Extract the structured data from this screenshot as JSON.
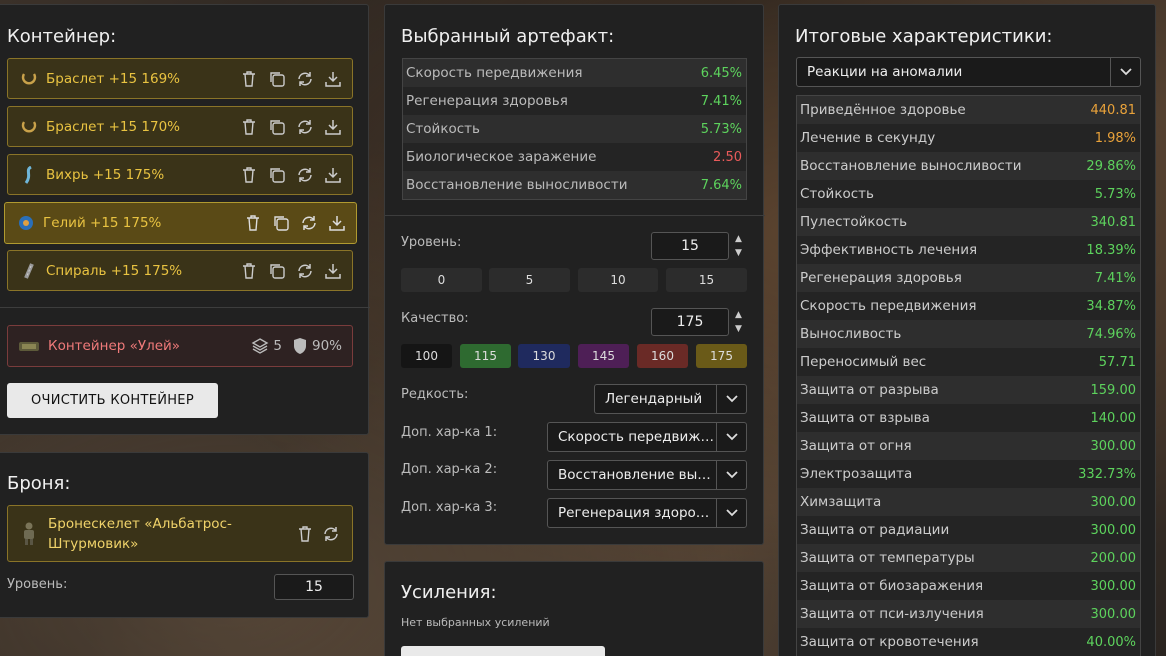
{
  "container": {
    "title": "Контейнер:",
    "artifacts": [
      {
        "label": "Браслет +15 169%",
        "icon": "bracelet-icon"
      },
      {
        "label": "Браслет +15 170%",
        "icon": "bracelet-icon"
      },
      {
        "label": "Вихрь +15 175%",
        "icon": "whirl-icon"
      },
      {
        "label": "Гелий +15 175%",
        "icon": "helium-icon",
        "selected": true
      },
      {
        "label": "Спираль +15 175%",
        "icon": "spiral-icon"
      }
    ],
    "container_item": {
      "label": "Контейнер «Улей»",
      "slots": "5",
      "protection": "90%"
    },
    "clear_button": "ОЧИСТИТЬ КОНТЕЙНЕР"
  },
  "armor": {
    "title": "Броня:",
    "name_line1": "Бронескелет «Альбатрос-",
    "name_line2": "Штурмовик»",
    "level_label": "Уровень:",
    "level_value": "15"
  },
  "artifact": {
    "title": "Выбранный артефакт:",
    "stats": [
      {
        "name": "Скорость передвижения",
        "value": "6.45%",
        "color": "green"
      },
      {
        "name": "Регенерация здоровья",
        "value": "7.41%",
        "color": "green"
      },
      {
        "name": "Стойкость",
        "value": "5.73%",
        "color": "green"
      },
      {
        "name": "Биологическое заражение",
        "value": "2.50",
        "color": "red"
      },
      {
        "name": "Восстановление выносливости",
        "value": "7.64%",
        "color": "green"
      }
    ],
    "level_label": "Уровень:",
    "level_value": "15",
    "level_presets": [
      "0",
      "5",
      "10",
      "15"
    ],
    "quality_label": "Качество:",
    "quality_value": "175",
    "quality_presets": [
      {
        "label": "100",
        "bg": "#151515"
      },
      {
        "label": "115",
        "bg": "#2e6a30"
      },
      {
        "label": "130",
        "bg": "#1f2a5e"
      },
      {
        "label": "145",
        "bg": "#4e1f56"
      },
      {
        "label": "160",
        "bg": "#6a2a26"
      },
      {
        "label": "175",
        "bg": "#6a5a18"
      }
    ],
    "rarity_label": "Редкость:",
    "rarity_value": "Легендарный",
    "extra1_label": "Доп. хар-ка 1:",
    "extra1_value": "Скорость передвижения",
    "extra2_label": "Доп. хар-ка 2:",
    "extra2_value": "Восстановление выносливости",
    "extra3_label": "Доп. хар-ка 3:",
    "extra3_value": "Регенерация здоровья"
  },
  "boosts": {
    "title": "Усиления:",
    "empty_text": "Нет выбранных усилений"
  },
  "summary": {
    "title": "Итоговые характеристики:",
    "filter_value": "Реакции на аномалии",
    "stats": [
      {
        "name": "Приведённое здоровье",
        "value": "440.81",
        "color": "orange"
      },
      {
        "name": "Лечение в секунду",
        "value": "1.98%",
        "color": "orange"
      },
      {
        "name": "Восстановление выносливости",
        "value": "29.86%",
        "color": "green"
      },
      {
        "name": "Стойкость",
        "value": "5.73%",
        "color": "green"
      },
      {
        "name": "Пулестойкость",
        "value": "340.81",
        "color": "green"
      },
      {
        "name": "Эффективность лечения",
        "value": "18.39%",
        "color": "green"
      },
      {
        "name": "Регенерация здоровья",
        "value": "7.41%",
        "color": "green"
      },
      {
        "name": "Скорость передвижения",
        "value": "34.87%",
        "color": "green"
      },
      {
        "name": "Выносливость",
        "value": "74.96%",
        "color": "green"
      },
      {
        "name": "Переносимый вес",
        "value": "57.71",
        "color": "green"
      },
      {
        "name": "Защита от разрыва",
        "value": "159.00",
        "color": "green"
      },
      {
        "name": "Защита от взрыва",
        "value": "140.00",
        "color": "green"
      },
      {
        "name": "Защита от огня",
        "value": "300.00",
        "color": "green"
      },
      {
        "name": "Электрозащита",
        "value": "332.73%",
        "color": "green"
      },
      {
        "name": "Химзащита",
        "value": "300.00",
        "color": "green"
      },
      {
        "name": "Защита от радиации",
        "value": "300.00",
        "color": "green"
      },
      {
        "name": "Защита от температуры",
        "value": "200.00",
        "color": "green"
      },
      {
        "name": "Защита от биозаражения",
        "value": "300.00",
        "color": "green"
      },
      {
        "name": "Защита от пси-излучения",
        "value": "300.00",
        "color": "green"
      },
      {
        "name": "Защита от кровотечения",
        "value": "40.00%",
        "color": "green"
      }
    ]
  }
}
